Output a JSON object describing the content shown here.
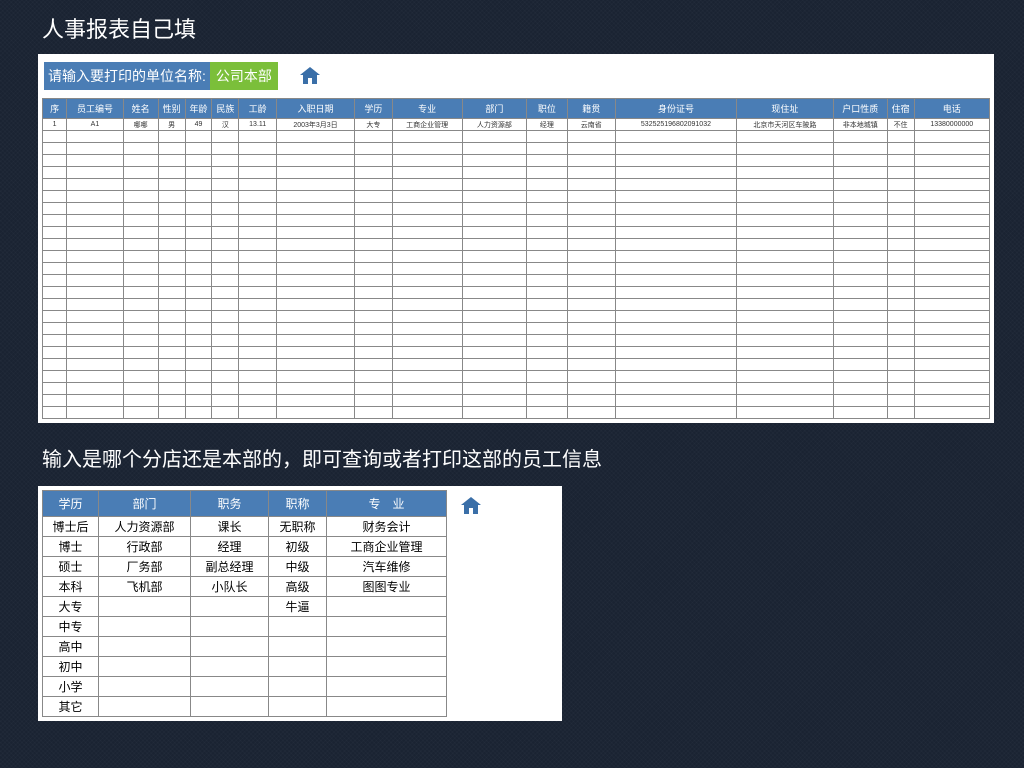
{
  "title_main": "人事报表自己填",
  "prompt_label": "请输入要打印的单位名称:",
  "prompt_value": "公司本部",
  "main_headers": [
    "序",
    "员工编号",
    "姓名",
    "性别",
    "年龄",
    "民族",
    "工龄",
    "入职日期",
    "学历",
    "专业",
    "部门",
    "职位",
    "籍贯",
    "身份证号",
    "现住址",
    "户口性质",
    "住宿",
    "电话"
  ],
  "main_row": [
    "1",
    "A1",
    "哪哪",
    "男",
    "49",
    "汉",
    "13.11",
    "2003年3月3日",
    "大专",
    "工商企业管理",
    "人力资源部",
    "经理",
    "云南省",
    "532525196802091032",
    "北京市天河区车陂路",
    "非本地城镇",
    "不住",
    "13380000000"
  ],
  "caption2": "输入是哪个分店还是本部的，即可查询或者打印这部的员工信息",
  "lookup_headers": [
    "学历",
    "部门",
    "职务",
    "职称",
    "专　业"
  ],
  "lookup_rows": [
    [
      "博士后",
      "人力资源部",
      "课长",
      "无职称",
      "财务会计"
    ],
    [
      "博士",
      "行政部",
      "经理",
      "初级",
      "工商企业管理"
    ],
    [
      "硕士",
      "厂务部",
      "副总经理",
      "中级",
      "汽车维修"
    ],
    [
      "本科",
      "飞机部",
      "小队长",
      "高级",
      "图图专业"
    ],
    [
      "大专",
      "",
      "",
      "牛逼",
      ""
    ],
    [
      "中专",
      "",
      "",
      "",
      ""
    ],
    [
      "高中",
      "",
      "",
      "",
      ""
    ],
    [
      "初中",
      "",
      "",
      "",
      ""
    ],
    [
      "小学",
      "",
      "",
      "",
      ""
    ],
    [
      "其它",
      "",
      "",
      "",
      ""
    ]
  ],
  "col_widths_main": [
    18,
    42,
    26,
    20,
    20,
    20,
    28,
    58,
    28,
    52,
    48,
    30,
    36,
    90,
    72,
    40,
    20,
    56
  ],
  "col_widths_lookup": [
    56,
    92,
    78,
    58,
    120
  ],
  "empty_rows": 24
}
